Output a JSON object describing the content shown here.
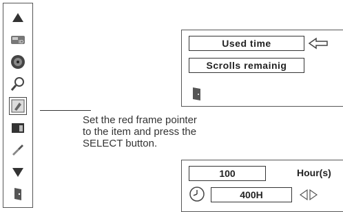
{
  "sidebar": {
    "items": [
      {
        "icon": "triangle-up-icon"
      },
      {
        "icon": "id-card-icon"
      },
      {
        "icon": "color-disc-icon"
      },
      {
        "icon": "magnifier-icon"
      },
      {
        "icon": "setting-icon",
        "selected": true
      },
      {
        "icon": "screen-icon"
      },
      {
        "icon": "wrench-icon"
      },
      {
        "icon": "triangle-down-icon"
      },
      {
        "icon": "exit-icon"
      }
    ]
  },
  "instruction": {
    "line1": "Set the red frame pointer",
    "line2": "to the item and press the",
    "line3": "SELECT button."
  },
  "menu": {
    "used_time_label": "Used time",
    "scrolls_remaining_label": "Scrolls remainig"
  },
  "timer": {
    "hours_value": "100",
    "hours_unit": "Hour(s)",
    "setting_value": "400H"
  }
}
